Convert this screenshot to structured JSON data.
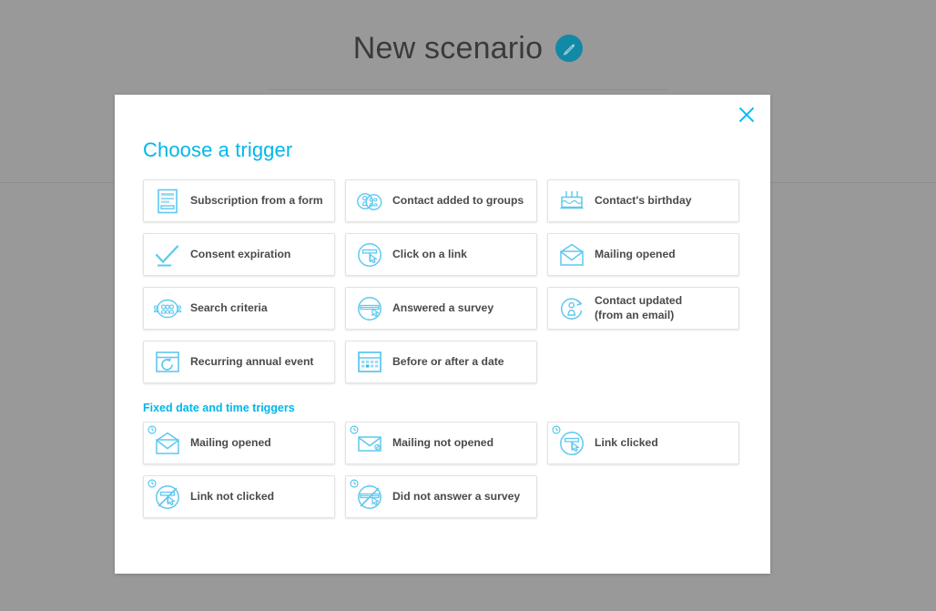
{
  "page": {
    "title": "New scenario",
    "edit_icon": "pencil-icon",
    "background_color": "#999999"
  },
  "modal": {
    "title": "Choose a trigger",
    "close_icon": "close-icon",
    "accent_color": "#00b7ea",
    "icon_color": "#4ec3ef",
    "background_color": "#ffffff",
    "sections": [
      {
        "label": "",
        "tiles": [
          {
            "label": "Subscription from a form",
            "icon": "form-document-icon",
            "clock": false
          },
          {
            "label": "Contact added to groups",
            "icon": "contact-groups-icon",
            "clock": false
          },
          {
            "label": "Contact's birthday",
            "icon": "birthday-cake-icon",
            "clock": false
          },
          {
            "label": "Consent expiration",
            "icon": "checkmark-icon",
            "clock": false
          },
          {
            "label": "Click on a link",
            "icon": "link-click-icon",
            "clock": false
          },
          {
            "label": "Mailing opened",
            "icon": "open-envelope-icon",
            "clock": false
          },
          {
            "label": "Search criteria",
            "icon": "search-criteria-icon",
            "clock": false
          },
          {
            "label": "Answered a survey",
            "icon": "survey-answered-icon",
            "clock": false
          },
          {
            "label": "Contact updated\n(from an email)",
            "icon": "contact-updated-icon",
            "clock": false
          },
          {
            "label": "Recurring annual event",
            "icon": "recurring-event-icon",
            "clock": false
          },
          {
            "label": "Before or after a date",
            "icon": "calendar-icon",
            "clock": false
          }
        ]
      },
      {
        "label": "Fixed date and time triggers",
        "tiles": [
          {
            "label": "Mailing opened",
            "icon": "open-envelope-icon",
            "clock": true
          },
          {
            "label": "Mailing not opened",
            "icon": "closed-envelope-icon",
            "clock": true
          },
          {
            "label": "Link clicked",
            "icon": "link-click-icon",
            "clock": true
          },
          {
            "label": "Link not clicked",
            "icon": "link-not-clicked-icon",
            "clock": true
          },
          {
            "label": "Did not answer a survey",
            "icon": "survey-not-answered-icon",
            "clock": true
          }
        ]
      }
    ]
  }
}
